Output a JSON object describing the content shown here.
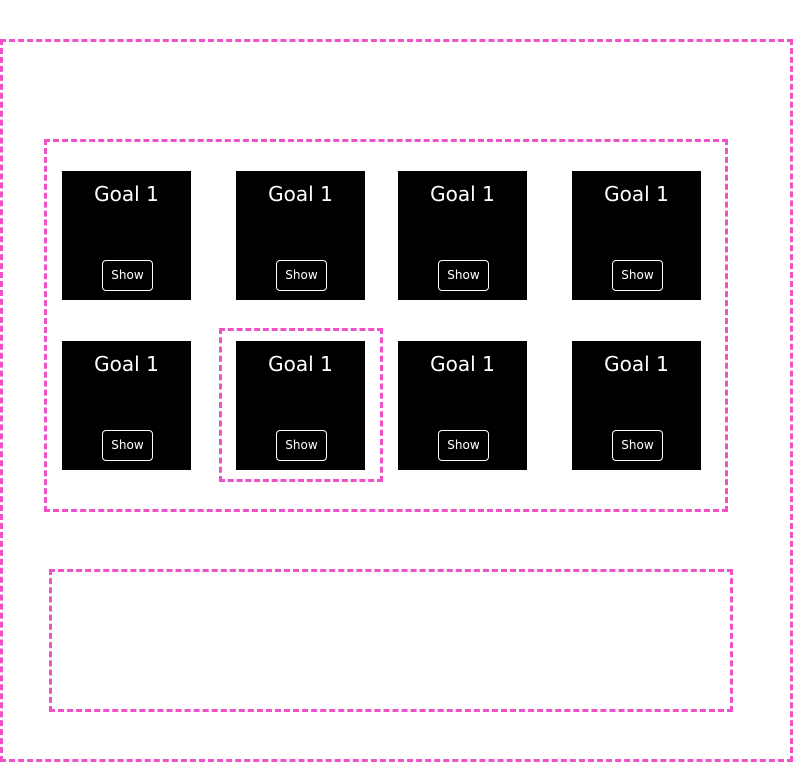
{
  "goals": [
    {
      "title": "Goal 1",
      "button_label": "Show"
    },
    {
      "title": "Goal 1",
      "button_label": "Show"
    },
    {
      "title": "Goal 1",
      "button_label": "Show"
    },
    {
      "title": "Goal 1",
      "button_label": "Show"
    },
    {
      "title": "Goal 1",
      "button_label": "Show"
    },
    {
      "title": "Goal 1",
      "button_label": "Show"
    },
    {
      "title": "Goal 1",
      "button_label": "Show"
    },
    {
      "title": "Goal 1",
      "button_label": "Show"
    }
  ],
  "colors": {
    "frame_border": "#f050c8",
    "card_background": "#000000",
    "card_text": "#ffffff"
  }
}
